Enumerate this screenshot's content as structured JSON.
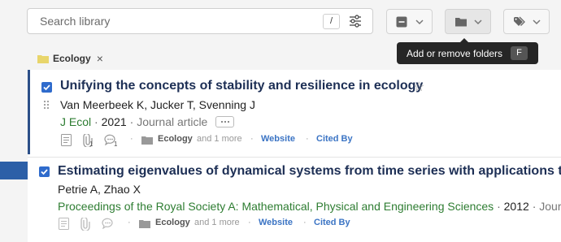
{
  "search": {
    "placeholder": "Search library",
    "shortcut": "/"
  },
  "toolbar": {
    "buttons": [
      {
        "icon": "checkbox-minus-icon"
      },
      {
        "icon": "folder-icon"
      },
      {
        "icon": "tags-icon"
      }
    ]
  },
  "tooltip": {
    "text": "Add or remove folders",
    "key": "F"
  },
  "filter": {
    "label": "Ecology",
    "remove": "×"
  },
  "items": [
    {
      "title": "Unifying the concepts of stability and resilience in ecology",
      "authors": "Van Meerbeek K, Jucker T, Svenning J",
      "journal": "J Ecol",
      "sep1": "·",
      "year": "2021",
      "sep2": "·",
      "type": "Journal article",
      "attachments": "1",
      "comments": "1",
      "folder": "Ecology",
      "more": "and 1 more",
      "website": "Website",
      "cited": "Cited By",
      "dot": "·"
    },
    {
      "title": "Estimating eigenvalues of dynamical systems from time series with applications to p",
      "authors": "Petrie A, Zhao X",
      "journal": "Proceedings of the Royal Society A: Mathematical, Physical and Engineering Sciences",
      "sep1": "·",
      "year": "2012",
      "sep2": "·",
      "type": "Jour",
      "folder": "Ecology",
      "more": "and 1 more",
      "website": "Website",
      "cited": "Cited By",
      "dot": "·"
    }
  ],
  "colors": {
    "accent": "#2c4f88",
    "checkbox": "#2f6bcc",
    "journal": "#2e7d32",
    "link": "#3b74c4",
    "folder": "#e8d56b"
  }
}
